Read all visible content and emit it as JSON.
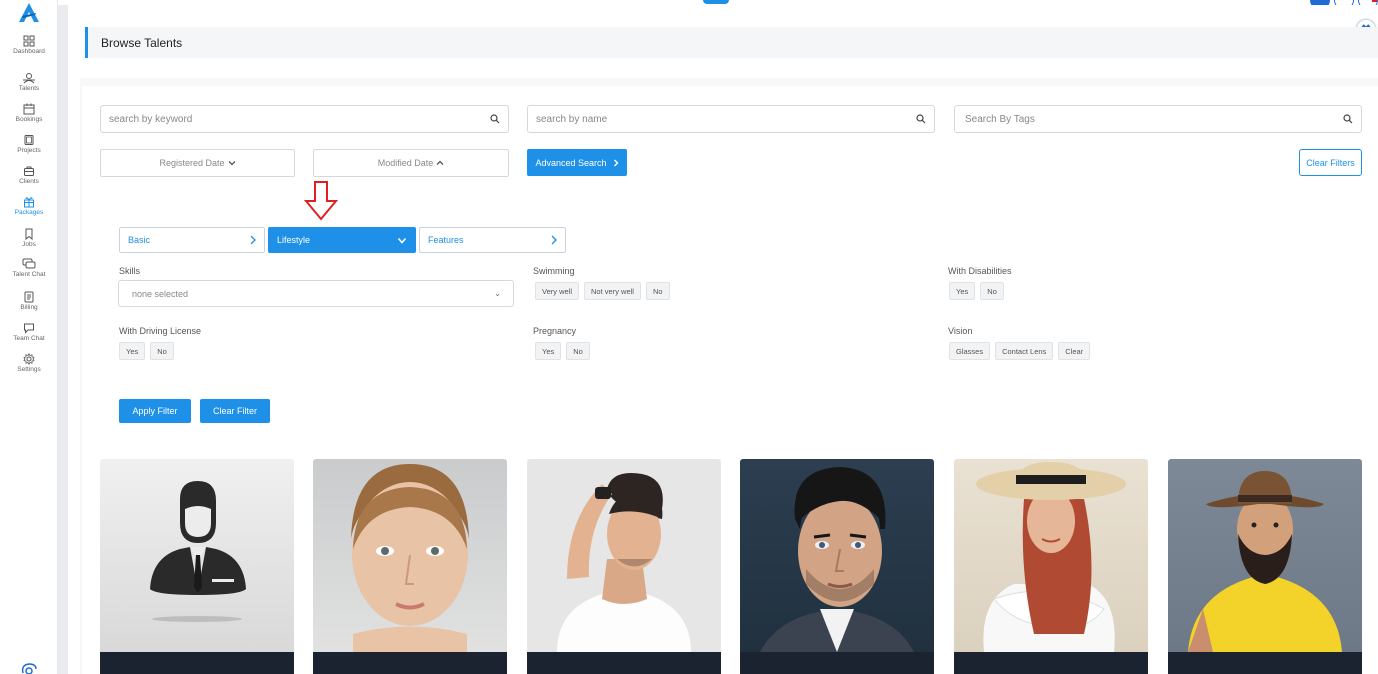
{
  "sidebar": {
    "items": [
      {
        "label": "Dashboard",
        "icon": "grid-icon"
      },
      {
        "label": "Talents",
        "icon": "users-icon"
      },
      {
        "label": "Bookings",
        "icon": "calendar-icon"
      },
      {
        "label": "Projects",
        "icon": "folder-icon"
      },
      {
        "label": "Clients",
        "icon": "briefcase-icon"
      },
      {
        "label": "Packages",
        "icon": "gift-icon"
      },
      {
        "label": "Jobs",
        "icon": "bookmark-icon"
      },
      {
        "label": "Talent Chat",
        "icon": "chat-icon"
      },
      {
        "label": "Billing",
        "icon": "document-icon"
      },
      {
        "label": "Team Chat",
        "icon": "message-icon"
      },
      {
        "label": "Settings",
        "icon": "gear-icon"
      }
    ],
    "active": "Packages"
  },
  "page": {
    "title": "Browse Talents"
  },
  "search": {
    "keyword_placeholder": "search by keyword",
    "name_placeholder": "search by name",
    "tags_placeholder": "Search By Tags"
  },
  "sort": {
    "registered": "Registered Date",
    "modified": "Modified Date"
  },
  "buttons": {
    "advanced_search": "Advanced Search",
    "clear_filters": "Clear Filters",
    "apply_filter": "Apply Filter",
    "clear_filter": "Clear Filter"
  },
  "tabs": [
    {
      "label": "Basic",
      "active": false
    },
    {
      "label": "Lifestyle",
      "active": true
    },
    {
      "label": "Features",
      "active": false
    }
  ],
  "filters": {
    "skills": {
      "label": "Skills",
      "value": "none selected"
    },
    "swimming": {
      "label": "Swimming",
      "options": [
        "Very well",
        "Not very well",
        "No"
      ]
    },
    "disabilities": {
      "label": "With Disabilities",
      "options": [
        "Yes",
        "No"
      ]
    },
    "driving": {
      "label": "With Driving License",
      "options": [
        "Yes",
        "No"
      ]
    },
    "pregnancy": {
      "label": "Pregnancy",
      "options": [
        "Yes",
        "No"
      ]
    },
    "vision": {
      "label": "Vision",
      "options": [
        "Glasses",
        "Contact Lens",
        "Clear"
      ]
    }
  },
  "colors": {
    "accent": "#1e90e8",
    "card_footer": "#1b2331",
    "annotation_arrow": "#e02020"
  }
}
